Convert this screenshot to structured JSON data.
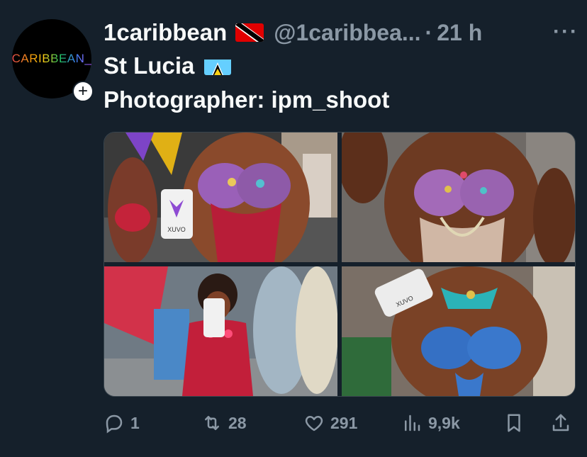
{
  "avatar": {
    "logo_text": "CARIBBEAN_"
  },
  "header": {
    "display_name": "1caribbean",
    "handle": "@1caribbea...",
    "separator": "·",
    "time": "21 h",
    "more_label": "···"
  },
  "tweet": {
    "line1": "St Lucia",
    "line2": "Photographer: ipm_shoot"
  },
  "media": {
    "cups": [
      {
        "brand": "XUVO"
      },
      {
        "brand": "XUVO"
      }
    ]
  },
  "actions": {
    "replies": "1",
    "retweets": "28",
    "likes": "291",
    "views": "9,9k"
  },
  "colors": {
    "background": "#15202b",
    "text_primary": "#f7f9f9",
    "text_secondary": "#8b98a5",
    "border": "#38444d"
  },
  "icons": [
    "caribbean-flag-tt",
    "flag-saint-lucia",
    "reply-icon",
    "retweet-icon",
    "like-icon",
    "views-icon",
    "bookmark-icon",
    "share-icon",
    "more-icon",
    "follow-plus-icon"
  ]
}
